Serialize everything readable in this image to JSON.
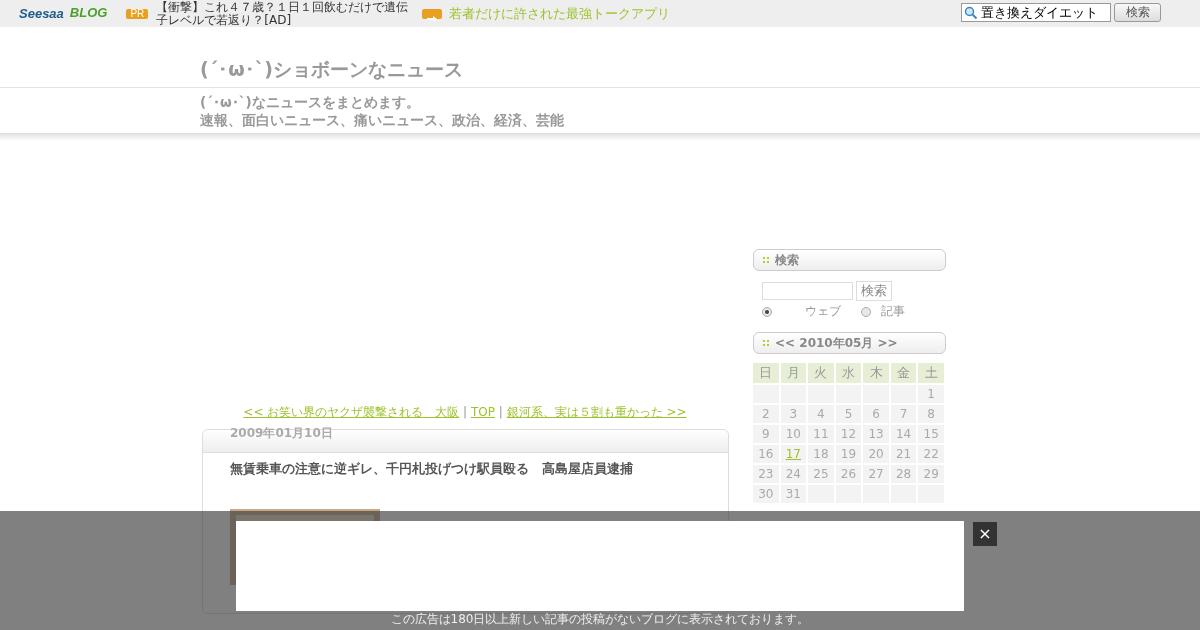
{
  "top_bar": {
    "logo": "Seesaa",
    "logo_suffix": "BLOG",
    "pr_badge": "PR",
    "pr_text": "【衝撃】これ４７歳？１日１回飲むだけで遺伝子レベルで若返り？[AD]",
    "promo_link": "若者だけに許された最強トークアプリ",
    "search_value": "置き換えダイエット",
    "search_button": "検索"
  },
  "header": {
    "title": "(´･ω･`)ショボーンなニュース",
    "description_lines": [
      "(´･ω･`)なニュースをまとめます。",
      "速報、面白いニュース、痛いニュース、政治、経済、芸能"
    ]
  },
  "nav": {
    "prev": "<< お笑い界のヤクザ襲撃される　大阪",
    "top": "TOP",
    "next": "銀河系、実は５割も重かった >>",
    "separator": "|"
  },
  "post": {
    "date": "2009年01月10日",
    "title": "無賃乗車の注意に逆ギレ、千円札投げつけ駅員殴る　高島屋店員逮捕"
  },
  "sidebar": {
    "search": {
      "heading": "検索",
      "button": "検索",
      "options": [
        {
          "label": "ウェブ",
          "selected": true
        },
        {
          "label": "記事",
          "selected": false
        }
      ]
    },
    "calendar": {
      "heading": "<< 2010年05月 >>",
      "weekdays": [
        "日",
        "月",
        "火",
        "水",
        "木",
        "金",
        "土"
      ],
      "weeks": [
        [
          {
            "kind": "empty"
          },
          {
            "kind": "empty"
          },
          {
            "kind": "empty"
          },
          {
            "kind": "empty"
          },
          {
            "kind": "empty"
          },
          {
            "kind": "empty"
          },
          {
            "kind": "day",
            "text": "1"
          }
        ],
        [
          {
            "kind": "day",
            "text": "2"
          },
          {
            "kind": "day",
            "text": "3"
          },
          {
            "kind": "day",
            "text": "4"
          },
          {
            "kind": "day",
            "text": "5"
          },
          {
            "kind": "day",
            "text": "6"
          },
          {
            "kind": "day",
            "text": "7"
          },
          {
            "kind": "day",
            "text": "8"
          }
        ],
        [
          {
            "kind": "day",
            "text": "9"
          },
          {
            "kind": "day",
            "text": "10"
          },
          {
            "kind": "day",
            "text": "11"
          },
          {
            "kind": "day",
            "text": "12"
          },
          {
            "kind": "day",
            "text": "13"
          },
          {
            "kind": "day",
            "text": "14"
          },
          {
            "kind": "day",
            "text": "15"
          }
        ],
        [
          {
            "kind": "day",
            "text": "16"
          },
          {
            "kind": "link",
            "text": "17"
          },
          {
            "kind": "day",
            "text": "18"
          },
          {
            "kind": "day",
            "text": "19"
          },
          {
            "kind": "day",
            "text": "20"
          },
          {
            "kind": "day",
            "text": "21"
          },
          {
            "kind": "day",
            "text": "22"
          }
        ],
        [
          {
            "kind": "day",
            "text": "23"
          },
          {
            "kind": "day",
            "text": "24"
          },
          {
            "kind": "day",
            "text": "25"
          },
          {
            "kind": "day",
            "text": "26"
          },
          {
            "kind": "day",
            "text": "27"
          },
          {
            "kind": "day",
            "text": "28"
          },
          {
            "kind": "day",
            "text": "29"
          }
        ],
        [
          {
            "kind": "day",
            "text": "30"
          },
          {
            "kind": "day",
            "text": "31"
          },
          {
            "kind": "empty"
          },
          {
            "kind": "empty"
          },
          {
            "kind": "empty"
          },
          {
            "kind": "empty"
          },
          {
            "kind": "empty"
          }
        ]
      ]
    }
  },
  "overlay": {
    "close": "×",
    "notice": "この広告は180日以上新しい記事の投稿がないブログに表示されております。"
  }
}
